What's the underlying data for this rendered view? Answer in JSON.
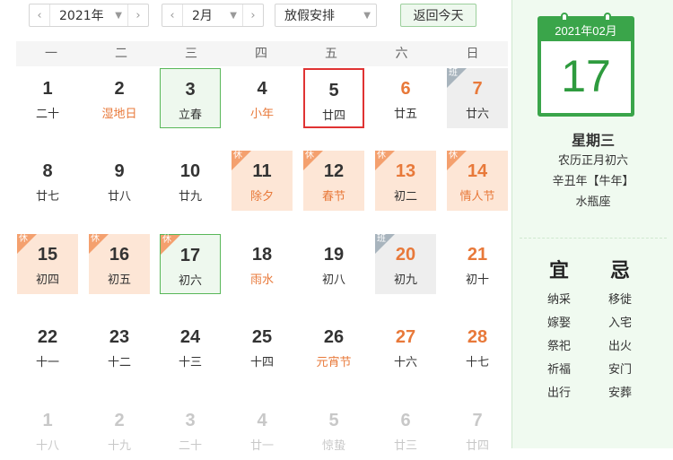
{
  "toolbar": {
    "year_value": "2021年",
    "month_value": "2月",
    "holiday_select": "放假安排",
    "today_button": "返回今天",
    "prev_icon": "chevron-left-icon",
    "next_icon": "chevron-right-icon"
  },
  "weekdays": [
    "一",
    "二",
    "三",
    "四",
    "五",
    "六",
    "日"
  ],
  "rows": [
    [
      {
        "day": "1",
        "sub": "二十"
      },
      {
        "day": "2",
        "sub": "湿地日",
        "festival": true
      },
      {
        "day": "3",
        "sub": "立春",
        "festival": true,
        "today": true
      },
      {
        "day": "4",
        "sub": "小年",
        "festival": true
      },
      {
        "day": "5",
        "sub": "廿四",
        "selected": true
      },
      {
        "day": "6",
        "sub": "廿五",
        "weekend": true
      },
      {
        "day": "7",
        "sub": "廿六",
        "weekend": true,
        "tag": "班"
      }
    ],
    [
      {
        "day": "8",
        "sub": "廿七"
      },
      {
        "day": "9",
        "sub": "廿八"
      },
      {
        "day": "10",
        "sub": "廿九"
      },
      {
        "day": "11",
        "sub": "除夕",
        "festival": true,
        "tag": "休"
      },
      {
        "day": "12",
        "sub": "春节",
        "festival": true,
        "tag": "休"
      },
      {
        "day": "13",
        "sub": "初二",
        "weekend": true,
        "tag": "休"
      },
      {
        "day": "14",
        "sub": "情人节",
        "weekend": true,
        "festival": true,
        "tag": "休"
      }
    ],
    [
      {
        "day": "15",
        "sub": "初四",
        "tag": "休"
      },
      {
        "day": "16",
        "sub": "初五",
        "tag": "休"
      },
      {
        "day": "17",
        "sub": "初六",
        "tag": "休",
        "today": true
      },
      {
        "day": "18",
        "sub": "雨水",
        "festival": true
      },
      {
        "day": "19",
        "sub": "初八"
      },
      {
        "day": "20",
        "sub": "初九",
        "weekend": true,
        "tag": "班"
      },
      {
        "day": "21",
        "sub": "初十",
        "weekend": true
      }
    ],
    [
      {
        "day": "22",
        "sub": "十一"
      },
      {
        "day": "23",
        "sub": "十二"
      },
      {
        "day": "24",
        "sub": "十三"
      },
      {
        "day": "25",
        "sub": "十四"
      },
      {
        "day": "26",
        "sub": "元宵节",
        "festival": true
      },
      {
        "day": "27",
        "sub": "十六",
        "weekend": true
      },
      {
        "day": "28",
        "sub": "十七",
        "weekend": true
      }
    ],
    [
      {
        "day": "1",
        "sub": "十八",
        "other": true
      },
      {
        "day": "2",
        "sub": "十九",
        "other": true
      },
      {
        "day": "3",
        "sub": "二十",
        "other": true
      },
      {
        "day": "4",
        "sub": "廿一",
        "other": true
      },
      {
        "day": "5",
        "sub": "惊蛰",
        "other": true
      },
      {
        "day": "6",
        "sub": "廿三",
        "other": true
      },
      {
        "day": "7",
        "sub": "廿四",
        "other": true
      }
    ]
  ],
  "panel": {
    "header": "2021年02月",
    "big_day": "17",
    "weekday": "星期三",
    "lunar": "农历正月初六",
    "ganzhi": "辛丑年【牛年】",
    "zodiac": "水瓶座",
    "yi_title": "宜",
    "ji_title": "忌",
    "yi": [
      "纳采",
      "嫁娶",
      "祭祀",
      "祈福",
      "出行"
    ],
    "ji": [
      "移徙",
      "入宅",
      "出火",
      "安门",
      "安葬"
    ]
  },
  "colors": {
    "green": "#3aa54a",
    "orange": "#e8793a",
    "holiday_bg": "#fde6d6",
    "selected_border": "#e03333"
  }
}
